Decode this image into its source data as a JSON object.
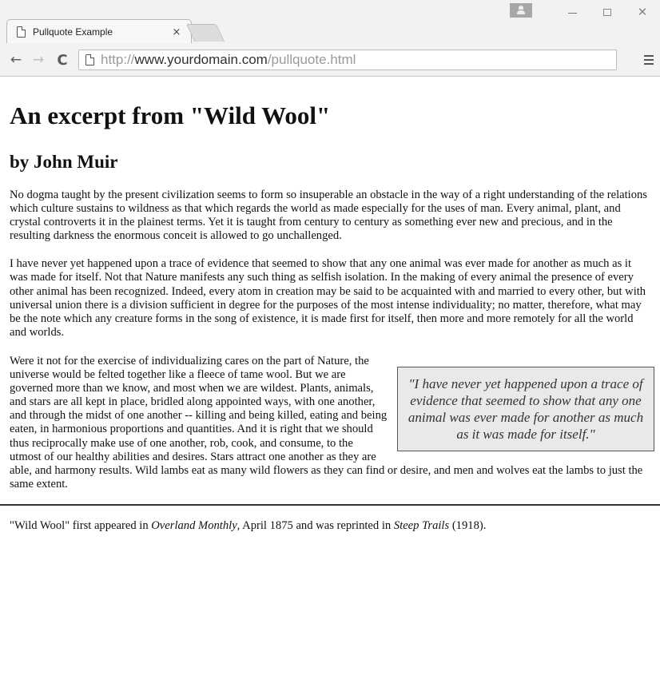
{
  "browser": {
    "tab_title": "Pullquote Example",
    "tab_close": "×",
    "url_scheme": "http://",
    "url_host": "www.yourdomain.com",
    "url_path": "/pullquote.html",
    "back_icon": "←",
    "forward_icon": "→",
    "reload_icon": "C",
    "close_icon": "✕"
  },
  "page": {
    "title": "An excerpt from \"Wild Wool\"",
    "byline": "by John Muir",
    "paragraph1": "No dogma taught by the present civilization seems to form so insuperable an obstacle in the way of a right understanding of the relations which culture sustains to wildness as that which regards the world as made especially for the uses of man. Every animal, plant, and crystal controverts it in the plainest terms. Yet it is taught from century to century as something ever new and precious, and in the resulting darkness the enormous conceit is allowed to go unchallenged.",
    "paragraph2": "I have never yet happened upon a trace of evidence that seemed to show that any one animal was ever made for another as much as it was made for itself. Not that Nature manifests any such thing as selfish isolation. In the making of every animal the presence of every other animal has been recognized. Indeed, every atom in creation may be said to be acquainted with and married to every other, but with universal union there is a division sufficient in degree for the purposes of the most intense individuality; no matter, therefore, what may be the note which any creature forms in the song of existence, it is made first for itself, then more and more remotely for all the world and worlds.",
    "pullquote": "\"I have never yet happened upon a trace of evidence that seemed to show that any one animal was ever made for another as much as it was made for itself.\"",
    "paragraph3": "Were it not for the exercise of individualizing cares on the part of Nature, the universe would be felted together like a fleece of tame wool. But we are governed more than we know, and most when we are wildest. Plants, animals, and stars are all kept in place, bridled along appointed ways, with one another, and through the midst of one another -- killing and being killed, eating and being eaten, in harmonious proportions and quantities. And it is right that we should thus reciprocally make use of one another, rob, cook, and consume, to the utmost of our healthy abilities and desires. Stars attract one another as they are able, and harmony results. Wild lambs eat as many wild flowers as they can find or desire, and men and wolves eat the lambs to just the same extent.",
    "footnote": {
      "part1": "\"Wild Wool\" first appeared in ",
      "publication": "Overland Monthly",
      "part2": ", April 1875 and was reprinted in ",
      "book": "Steep Trails",
      "part3": " (1918)."
    }
  }
}
